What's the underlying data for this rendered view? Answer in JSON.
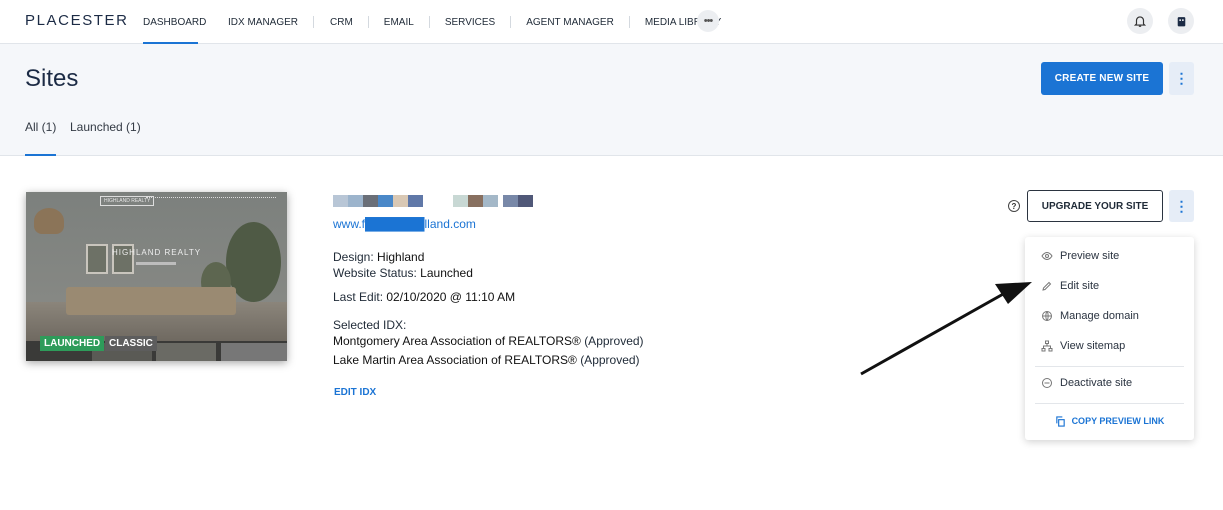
{
  "brand": "PLACESTER",
  "nav": [
    {
      "label": "DASHBOARD",
      "active": true
    },
    {
      "label": "IDX MANAGER"
    },
    {
      "label": "CRM"
    },
    {
      "label": "EMAIL"
    },
    {
      "label": "SERVICES"
    },
    {
      "label": "AGENT MANAGER"
    },
    {
      "label": "MEDIA LIBRARY"
    }
  ],
  "header": {
    "title": "Sites",
    "create_label": "CREATE NEW SITE",
    "tabs": [
      {
        "label": "All (1)",
        "active": true
      },
      {
        "label": "Launched (1)"
      }
    ]
  },
  "site": {
    "thumbnail": {
      "brand": "HIGHLAND REALTY",
      "title": "HIGHLAND REALTY",
      "badges": [
        "LAUNCHED",
        "CLASSIC"
      ]
    },
    "url": "www.f███████lland.com",
    "design_label": "Design:",
    "design_value": "Highland",
    "status_label": "Website Status:",
    "status_value": "Launched",
    "last_edit_label": "Last Edit:",
    "last_edit_value": "02/10/2020 @ 11:10 AM",
    "idx_label": "Selected IDX:",
    "idx": [
      {
        "name": "Montgomery Area Association of REALTORS®",
        "status": "(Approved)"
      },
      {
        "name": "Lake Martin Area Association of REALTORS®",
        "status": "(Approved)"
      }
    ],
    "edit_idx_label": "EDIT IDX",
    "upgrade_label": "UPGRADE YOUR SITE"
  },
  "menu": {
    "items": [
      {
        "label": "Preview site",
        "icon": "eye-icon"
      },
      {
        "label": "Edit site",
        "icon": "pencil-icon"
      },
      {
        "label": "Manage domain",
        "icon": "globe-icon"
      },
      {
        "label": "View sitemap",
        "icon": "sitemap-icon"
      }
    ],
    "deactivate_label": "Deactivate site",
    "copy_link_label": "COPY PREVIEW LINK"
  },
  "colors": {
    "accent": "#1b74d4",
    "launched_badge": "#2e9b5a",
    "classic_badge": "#5d5d5d"
  }
}
